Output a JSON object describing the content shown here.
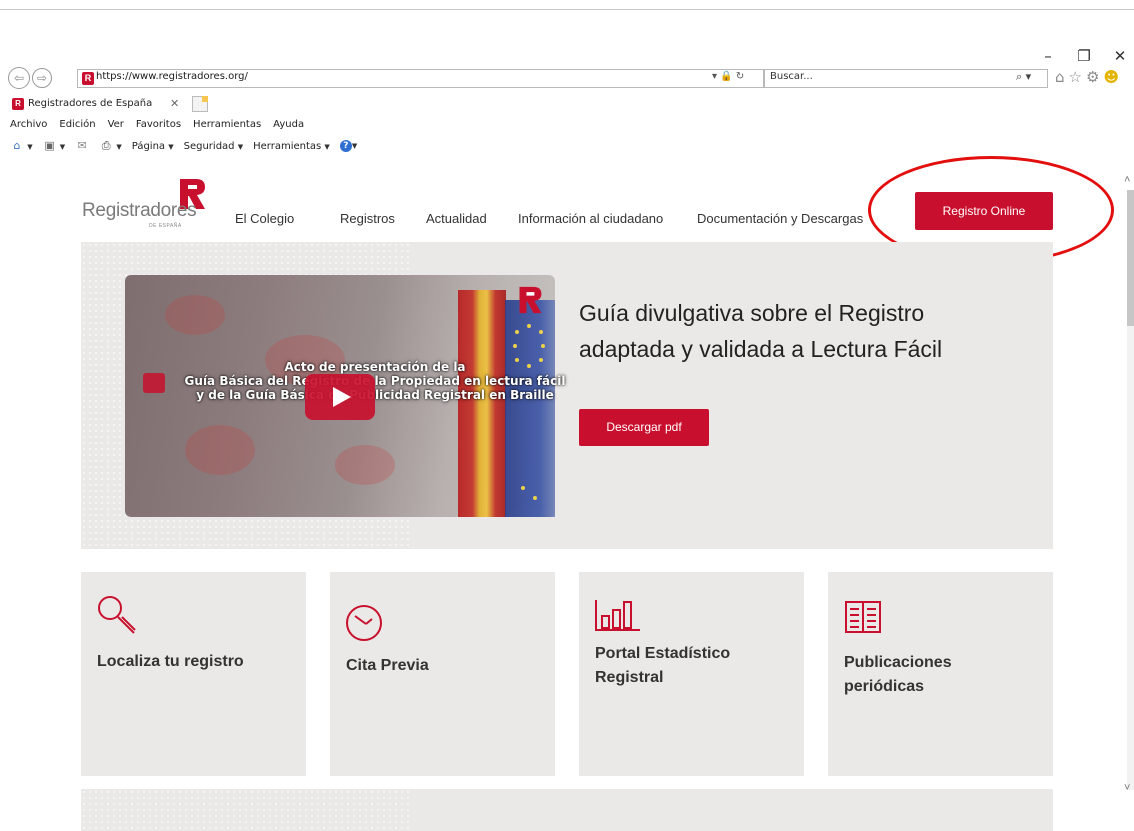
{
  "window": {
    "minimize": "–",
    "restore": "❐",
    "close": "✕"
  },
  "browser": {
    "back": "⇦",
    "forward": "⇨",
    "url": "https://www.registradores.org/",
    "url_icons": "▾ 🔒 ↻",
    "search_placeholder": "Buscar...",
    "search_icon": "⌕ ▾",
    "tab_title": "Registradores de España",
    "tab_close": "✕",
    "favicon_letter": "R",
    "toolbar_icons": [
      "home-icon",
      "star-icon",
      "gear-icon",
      "smiley-icon"
    ],
    "menu": [
      "Archivo",
      "Edición",
      "Ver",
      "Favoritos",
      "Herramientas",
      "Ayuda"
    ],
    "command_bar": {
      "page": "Página",
      "security": "Seguridad",
      "tools": "Herramientas"
    }
  },
  "site": {
    "brand": {
      "name": "Registradores",
      "sub": "DE ESPAÑA",
      "color": "#c8102e"
    },
    "nav": [
      "El Colegio",
      "Registros",
      "Actualidad",
      "Información al ciudadano",
      "Documentación y Descargas"
    ],
    "cta": "Registro Online",
    "hero": {
      "video_lines": [
        "Acto de presentación de la",
        "Guía Básica del Registro de la Propiedad en lectura fácil",
        "y de la Guía Básica de Publicidad Registral en Braille"
      ],
      "heading_line1": "Guía divulgativa sobre el Registro",
      "heading_line2": "adaptada y validada a Lectura Fácil",
      "button": "Descargar pdf"
    },
    "cards": [
      {
        "title": "Localiza tu registro",
        "icon": "magnifier-icon"
      },
      {
        "title": "Cita Previa",
        "icon": "clock-icon"
      },
      {
        "title_line1": "Portal Estadístico",
        "title_line2": "Registral",
        "icon": "bar-chart-icon"
      },
      {
        "title_line1": "Publicaciones",
        "title_line2": "periódicas",
        "icon": "book-icon"
      }
    ]
  },
  "colors": {
    "accent": "#c8102e",
    "annotation": "#e30e0e",
    "panel": "#ebe9e7"
  }
}
